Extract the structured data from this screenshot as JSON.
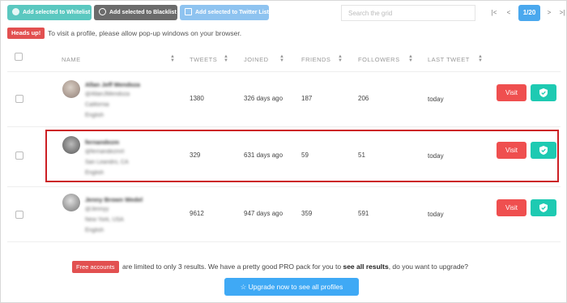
{
  "toolbar": {
    "whitelist_label": "Add selected to Whitelist",
    "blacklist_label": "Add selected to Blacklist",
    "twitter_list_label": "Add selected to Twitter List"
  },
  "search": {
    "placeholder": "Search the grid"
  },
  "pagination": {
    "first": "|<",
    "prev": "<",
    "current": "1/20",
    "next": ">",
    "last": ">|"
  },
  "notice": {
    "badge": "Heads up!",
    "text": "To visit a profile, please allow pop-up windows on your browser."
  },
  "table": {
    "headers": [
      "NAME",
      "TWEETS",
      "JOINED",
      "FRIENDS",
      "FOLLOWERS",
      "LAST TWEET"
    ],
    "rows": [
      {
        "name": "Allan Jeff Mendoza",
        "handle": "@AllanJMendoza",
        "location": "California",
        "language": "English",
        "tweets": "1380",
        "joined": "326 days ago",
        "friends": "187",
        "followers": "206",
        "last_tweet": "today"
      },
      {
        "name": "fernandezm",
        "handle": "@fernandezmrt",
        "location": "San Leandro, CA",
        "language": "English",
        "tweets": "329",
        "joined": "631 days ago",
        "friends": "59",
        "followers": "51",
        "last_tweet": "today"
      },
      {
        "name": "Jenny Brown Wedel",
        "handle": "@Jennyy",
        "location": "New York, USA",
        "language": "English",
        "tweets": "9612",
        "joined": "947 days ago",
        "friends": "359",
        "followers": "591",
        "last_tweet": "today"
      }
    ],
    "visit_label": "Visit"
  },
  "footer": {
    "badge": "Free accounts",
    "text_part1": "are limited to only 3 results. We have a pretty good PRO pack for you to",
    "text_bold": "see all results",
    "text_part2": ", do you want to upgrade?",
    "upgrade_label": "Upgrade now to see all profiles"
  },
  "colors": {
    "whitelist": "#5bc8c0",
    "blacklist": "#6b6b6b",
    "twitter_list": "#8ec3f0",
    "visit": "#ef4f4f",
    "shield": "#1ecab2",
    "upgrade": "#3fa9f5",
    "highlight": "#cc1f24"
  }
}
